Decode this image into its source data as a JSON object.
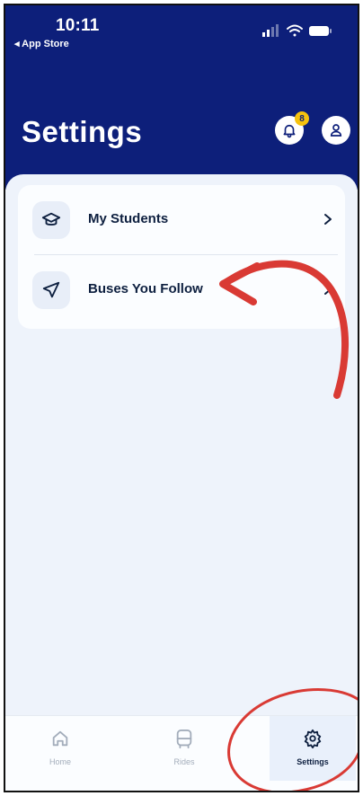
{
  "status_bar": {
    "time": "10:11",
    "back_app": "◂ App Store"
  },
  "header": {
    "title": "Settings",
    "notification_count": "8"
  },
  "settings_list": [
    {
      "label": "My Students",
      "icon": "graduation-cap-icon"
    },
    {
      "label": "Buses You Follow",
      "icon": "navigation-arrow-icon"
    }
  ],
  "tabbar": {
    "tabs": [
      {
        "label": "Home",
        "icon": "home-icon"
      },
      {
        "label": "Rides",
        "icon": "bus-icon"
      },
      {
        "label": "Settings",
        "icon": "gear-icon",
        "active": true
      }
    ]
  },
  "colors": {
    "header_bg": "#0d1f7a",
    "annotation": "#d93a34",
    "badge": "#f6c20e",
    "panel_bg": "#eef3fb"
  }
}
